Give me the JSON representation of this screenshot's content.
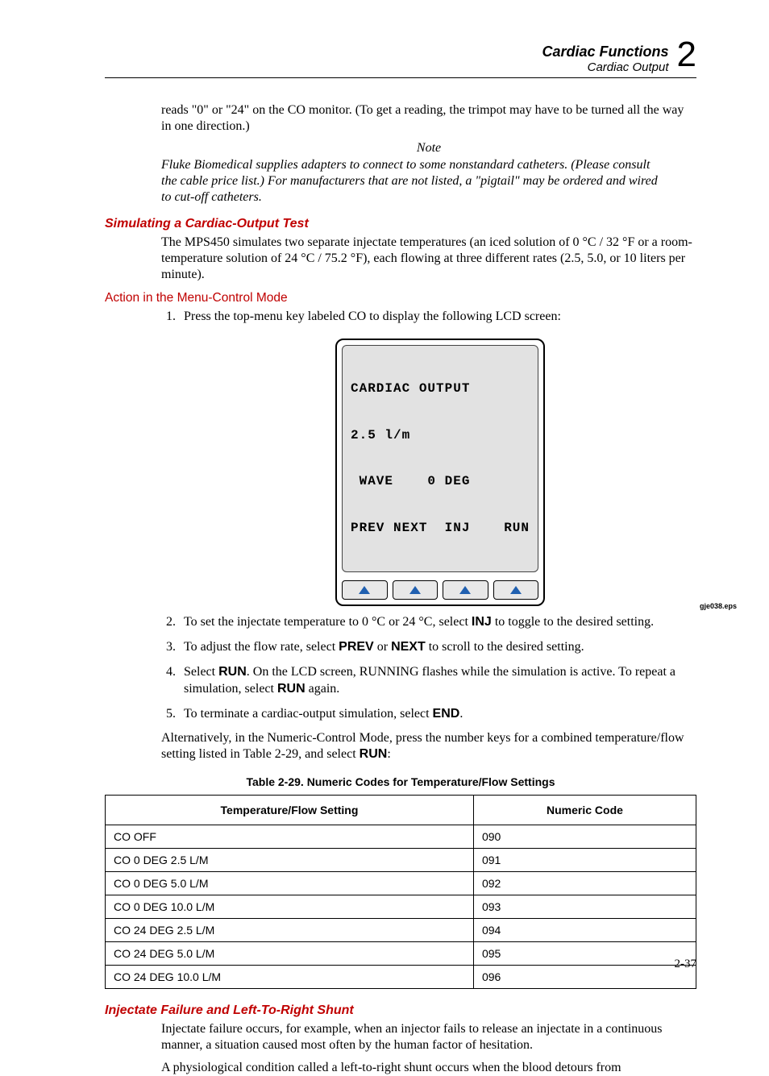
{
  "header": {
    "title": "Cardiac Functions",
    "subtitle": "Cardiac Output",
    "chapter_number": "2"
  },
  "intro_para": "reads \"0\" or \"24\" on the CO monitor. (To get a reading, the trimpot may have to be turned all the way in one direction.)",
  "note": {
    "label": "Note",
    "body": "Fluke Biomedical supplies adapters to connect to some nonstandard catheters. (Please consult the cable price list.) For manufacturers that are not listed, a \"pigtail\" may be ordered and wired to cut-off catheters."
  },
  "section1": {
    "heading": "Simulating a Cardiac-Output Test",
    "para": "The MPS450 simulates two separate injectate temperatures (an iced solution of 0 °C / 32 °F or a room-temperature solution of 24 °C / 75.2 °F), each flowing at three different rates (2.5, 5.0, or 10 liters per minute)."
  },
  "action_heading": "Action in the Menu-Control Mode",
  "steps": {
    "s1": "Press the top-menu key labeled CO to display the following LCD screen:",
    "s2_pre": "To set the injectate temperature to 0 °C or 24 °C, select ",
    "s2_inj": "INJ",
    "s2_post": " to toggle to the desired setting.",
    "s3_pre": "To adjust the flow rate, select ",
    "s3_prev": "PREV",
    "s3_or": " or ",
    "s3_next": "NEXT",
    "s3_post": " to scroll to the desired setting.",
    "s4_pre": "Select ",
    "s4_run1": "RUN",
    "s4_mid": ". On the LCD screen, RUNNING flashes while the simulation is active. To repeat a simulation, select ",
    "s4_run2": "RUN",
    "s4_post": " again.",
    "s5_pre": "To terminate a cardiac-output simulation, select ",
    "s5_end": "END",
    "s5_post": "."
  },
  "lcd": {
    "line1": "CARDIAC OUTPUT",
    "line2": "2.5 l/m",
    "line3_left": " WAVE",
    "line3_right": "0 DEG",
    "line4_a": "PREV",
    "line4_b": "NEXT",
    "line4_c": "INJ",
    "line4_d": "RUN",
    "eps": "gje038.eps"
  },
  "alt_para_pre": "Alternatively, in the Numeric-Control Mode, press the number keys for a combined temperature/flow setting listed in Table 2-29, and select ",
  "alt_para_run": "RUN",
  "alt_para_post": ":",
  "table": {
    "caption": "Table 2-29. Numeric Codes for Temperature/Flow Settings",
    "head_left": "Temperature/Flow Setting",
    "head_right": "Numeric Code",
    "rows": [
      {
        "setting": "CO OFF",
        "code": "090"
      },
      {
        "setting": "CO 0 DEG 2.5 L/M",
        "code": "091"
      },
      {
        "setting": "CO 0 DEG 5.0 L/M",
        "code": "092"
      },
      {
        "setting": "CO 0 DEG 10.0 L/M",
        "code": "093"
      },
      {
        "setting": "CO 24 DEG 2.5 L/M",
        "code": "094"
      },
      {
        "setting": "CO 24 DEG 5.0 L/M",
        "code": "095"
      },
      {
        "setting": "CO 24 DEG 10.0 L/M",
        "code": "096"
      }
    ]
  },
  "section2": {
    "heading": "Injectate Failure and Left-To-Right Shunt",
    "para1": "Injectate failure occurs, for example, when an injector fails to release an injectate in a continuous manner, a situation caused most often by the human factor of hesitation.",
    "para2": "A physiological condition called a left-to-right shunt occurs when the blood detours from"
  },
  "page_number": "2-37"
}
